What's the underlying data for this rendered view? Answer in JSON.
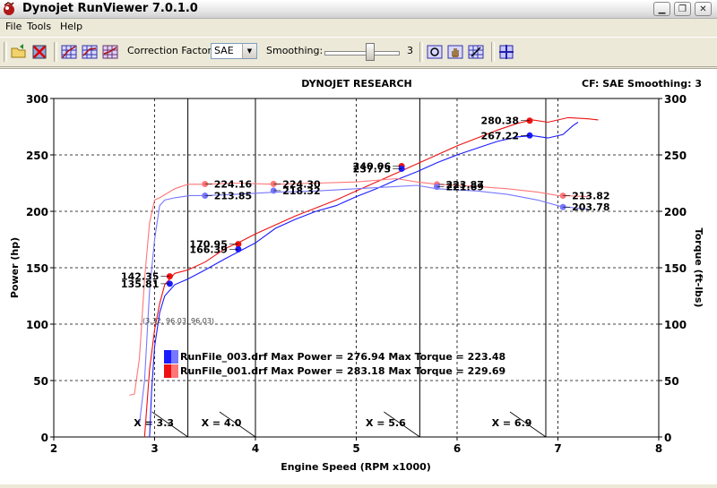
{
  "window": {
    "title": "Dynojet RunViewer 7.0.1.0",
    "controls": [
      "minimize",
      "restore",
      "close"
    ]
  },
  "menu": [
    "File",
    "Tools",
    "Help"
  ],
  "toolbar": {
    "correction_label": "Correction Factor:",
    "correction_value": "SAE",
    "smoothing_label": "Smoothing:",
    "smoothing_value": "3",
    "smoothing_level": 3,
    "smoothing_max": 5
  },
  "chart": {
    "header": "DYNOJET RESEARCH",
    "status": "CF: SAE  Smoothing: 3"
  },
  "chart_data": {
    "type": "line",
    "xlabel": "Engine Speed (RPM x1000)",
    "ylabel_left": "Power (hp)",
    "ylabel_right": "Torque (ft-lbs)",
    "xlim": [
      2,
      8
    ],
    "ylim_left": [
      0,
      300
    ],
    "ylim_right": [
      0,
      300
    ],
    "x_ticks": [
      "2",
      "3",
      "4",
      "5",
      "6",
      "7",
      "8"
    ],
    "y_ticks": [
      "0",
      "50",
      "100",
      "150",
      "200",
      "250",
      "300"
    ],
    "grid": true,
    "cursor_note": "(3.32, 96.03, 96.03)",
    "markers": [
      "X = 3.3",
      "X = 4.0",
      "X = 5.6",
      "X = 6.9"
    ],
    "marker_x": [
      3.33,
      4.0,
      5.63,
      6.88
    ],
    "legend": [
      "RunFile_003.drf Max Power = 276.94 Max Torque = 223.48",
      "RunFile_001.drf Max Power = 283.18 Max Torque = 229.69"
    ],
    "series": [
      {
        "name": "RunFile_003.drf Power",
        "color": "#1a1aff",
        "points": [
          [
            2.95,
            0
          ],
          [
            2.97,
            40
          ],
          [
            3.0,
            80
          ],
          [
            3.05,
            110
          ],
          [
            3.1,
            125
          ],
          [
            3.2,
            135
          ],
          [
            3.33,
            140
          ],
          [
            3.5,
            148
          ],
          [
            3.7,
            158
          ],
          [
            3.85,
            165
          ],
          [
            4.0,
            172
          ],
          [
            4.2,
            185
          ],
          [
            4.4,
            193
          ],
          [
            4.6,
            200
          ],
          [
            4.8,
            205
          ],
          [
            5.0,
            213
          ],
          [
            5.2,
            220
          ],
          [
            5.4,
            228
          ],
          [
            5.6,
            235
          ],
          [
            5.8,
            243
          ],
          [
            6.0,
            250
          ],
          [
            6.2,
            256
          ],
          [
            6.4,
            262
          ],
          [
            6.6,
            266
          ],
          [
            6.75,
            267
          ],
          [
            6.9,
            265
          ],
          [
            7.05,
            268
          ],
          [
            7.15,
            276
          ],
          [
            7.2,
            279
          ]
        ]
      },
      {
        "name": "RunFile_001.drf Power",
        "color": "#ee1111",
        "points": [
          [
            2.9,
            0
          ],
          [
            2.95,
            60
          ],
          [
            3.0,
            95
          ],
          [
            3.05,
            118
          ],
          [
            3.1,
            135
          ],
          [
            3.2,
            145
          ],
          [
            3.33,
            148
          ],
          [
            3.5,
            155
          ],
          [
            3.7,
            167
          ],
          [
            3.85,
            173
          ],
          [
            4.0,
            180
          ],
          [
            4.2,
            188
          ],
          [
            4.4,
            196
          ],
          [
            4.6,
            203
          ],
          [
            4.8,
            210
          ],
          [
            5.0,
            218
          ],
          [
            5.2,
            226
          ],
          [
            5.4,
            234
          ],
          [
            5.6,
            242
          ],
          [
            5.8,
            250
          ],
          [
            6.0,
            258
          ],
          [
            6.2,
            265
          ],
          [
            6.4,
            272
          ],
          [
            6.6,
            278
          ],
          [
            6.75,
            281
          ],
          [
            6.9,
            279
          ],
          [
            7.1,
            283
          ],
          [
            7.3,
            282
          ],
          [
            7.4,
            281
          ]
        ]
      },
      {
        "name": "RunFile_003.drf Torque",
        "color": "#7777ff",
        "points": [
          [
            2.85,
            12
          ],
          [
            2.9,
            50
          ],
          [
            2.95,
            130
          ],
          [
            3.0,
            175
          ],
          [
            3.05,
            205
          ],
          [
            3.1,
            210
          ],
          [
            3.2,
            212
          ],
          [
            3.35,
            214
          ],
          [
            3.5,
            214
          ],
          [
            3.8,
            215
          ],
          [
            4.2,
            217
          ],
          [
            4.6,
            218
          ],
          [
            5.0,
            220
          ],
          [
            5.4,
            222
          ],
          [
            5.6,
            223
          ],
          [
            5.8,
            220
          ],
          [
            6.0,
            219
          ],
          [
            6.2,
            218
          ],
          [
            6.5,
            215
          ],
          [
            6.8,
            210
          ],
          [
            7.0,
            205
          ],
          [
            7.05,
            204
          ],
          [
            7.3,
            202
          ]
        ]
      },
      {
        "name": "RunFile_001.drf Torque",
        "color": "#ff7777",
        "points": [
          [
            2.75,
            37
          ],
          [
            2.8,
            38
          ],
          [
            2.85,
            70
          ],
          [
            2.9,
            140
          ],
          [
            2.95,
            190
          ],
          [
            3.0,
            210
          ],
          [
            3.05,
            212
          ],
          [
            3.2,
            220
          ],
          [
            3.33,
            224
          ],
          [
            3.5,
            224
          ],
          [
            3.8,
            225
          ],
          [
            4.2,
            224
          ],
          [
            4.6,
            225
          ],
          [
            5.0,
            226
          ],
          [
            5.4,
            229
          ],
          [
            5.6,
            226
          ],
          [
            5.8,
            224
          ],
          [
            6.0,
            223
          ],
          [
            6.2,
            222
          ],
          [
            6.5,
            220
          ],
          [
            6.8,
            217
          ],
          [
            7.0,
            214
          ],
          [
            7.05,
            214
          ],
          [
            7.3,
            213
          ]
        ]
      }
    ],
    "labels": [
      {
        "text": "280.38",
        "x": 6.72,
        "y": 280.38,
        "color": "#ee1111",
        "side": "left"
      },
      {
        "text": "267.22",
        "x": 6.72,
        "y": 267.22,
        "color": "#1a1aff",
        "side": "left"
      },
      {
        "text": "240.06",
        "x": 5.45,
        "y": 240.06,
        "color": "#ee1111",
        "side": "left"
      },
      {
        "text": "237.73",
        "x": 5.45,
        "y": 237.73,
        "color": "#1a1aff",
        "side": "left"
      },
      {
        "text": "224.16",
        "x": 3.5,
        "y": 224.16,
        "color": "#ff7777",
        "side": "right"
      },
      {
        "text": "213.85",
        "x": 3.5,
        "y": 213.85,
        "color": "#7777ff",
        "side": "right"
      },
      {
        "text": "224.30",
        "x": 4.18,
        "y": 224.3,
        "color": "#ff7777",
        "side": "right"
      },
      {
        "text": "218.32",
        "x": 4.18,
        "y": 218.32,
        "color": "#7777ff",
        "side": "right"
      },
      {
        "text": "223.87",
        "x": 5.8,
        "y": 223.87,
        "color": "#ff7777",
        "side": "right"
      },
      {
        "text": "221.69",
        "x": 5.8,
        "y": 221.69,
        "color": "#7777ff",
        "side": "right"
      },
      {
        "text": "213.82",
        "x": 7.05,
        "y": 213.82,
        "color": "#ff7777",
        "side": "right"
      },
      {
        "text": "203.78",
        "x": 7.05,
        "y": 203.78,
        "color": "#7777ff",
        "side": "right"
      },
      {
        "text": "170.95",
        "x": 3.83,
        "y": 170.95,
        "color": "#ee1111",
        "side": "left"
      },
      {
        "text": "166.39",
        "x": 3.83,
        "y": 166.39,
        "color": "#1a1aff",
        "side": "left"
      },
      {
        "text": "142.35",
        "x": 3.15,
        "y": 142.35,
        "color": "#ee1111",
        "side": "left"
      },
      {
        "text": "135.81",
        "x": 3.15,
        "y": 135.81,
        "color": "#1a1aff",
        "side": "left"
      }
    ]
  }
}
